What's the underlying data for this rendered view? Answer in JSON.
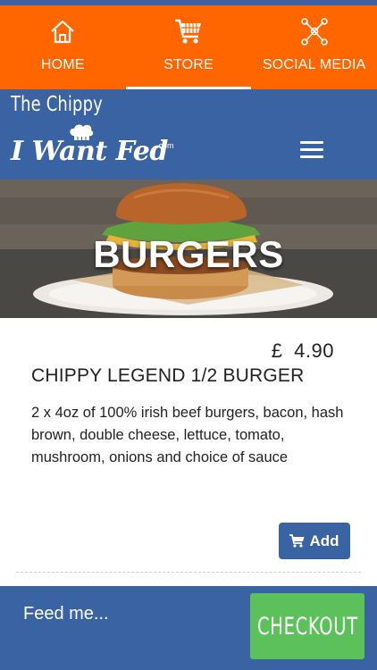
{
  "tabs": [
    {
      "label": "HOME",
      "icon": "home-icon"
    },
    {
      "label": "STORE",
      "icon": "cart-icon",
      "active": true
    },
    {
      "label": "SOCIAL MEDIA",
      "icon": "network-icon"
    }
  ],
  "brand": {
    "place_name": "The Chippy",
    "logo_text": "I Want Fed",
    "logo_suffix": ".com"
  },
  "hero": {
    "title": "BURGERS"
  },
  "item": {
    "price_currency": "£",
    "price_value": "4.90",
    "title": "CHIPPY LEGEND 1/2 BURGER",
    "description": "2 x 4oz of 100% irish beef burgers, bacon, hash brown, double cheese, lettuce, tomato, mushroom, onions and choice of sauce",
    "add_label": "Add"
  },
  "footer": {
    "feed_label": "Feed me...",
    "checkout_label": "CHECKOUT"
  },
  "colors": {
    "tab_bar": "#ff6600",
    "brand_blue": "#3a63a3",
    "checkout_green": "#5cc15a"
  }
}
